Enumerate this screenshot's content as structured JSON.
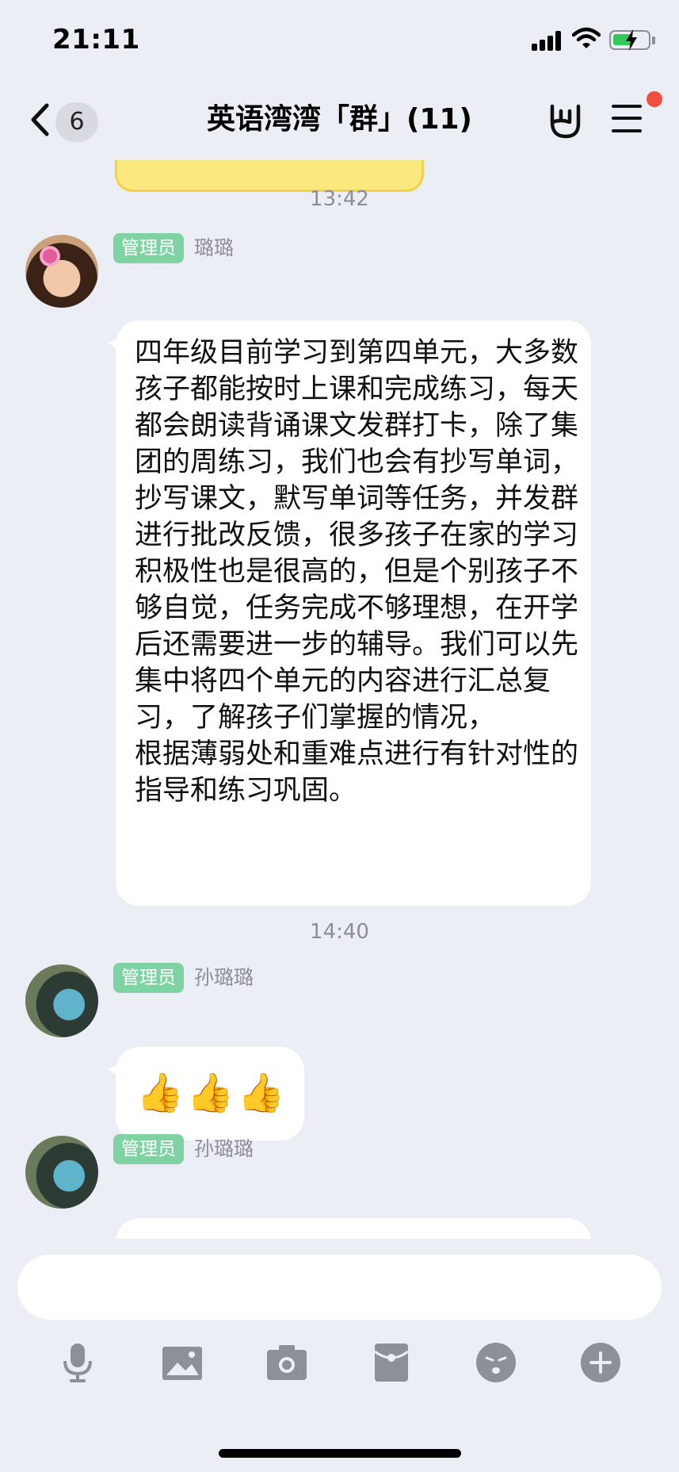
{
  "status_bar": {
    "time": "21:11"
  },
  "header": {
    "unread_count": "6",
    "title": "英语湾湾「群」(11)"
  },
  "messages": [
    {
      "time": "13:42",
      "role": "管理员",
      "sender": "璐璐",
      "text": "四年级目前学习到第四单元，大多数孩子都能按时上课和完成练习，每天都会朗读背诵课文发群打卡，除了集团的周练习，我们也会有抄写单词，抄写课文，默写单词等任务，并发群进行批改反馈，很多孩子在家的学习积极性也是很高的，但是个别孩子不够自觉，任务完成不够理想，在开学后还需要进一步的辅导。我们可以先集中将四个单元的内容进行汇总复习，了解孩子们掌握的情况，\n根据薄弱处和重难点进行有针对性的指导和练习巩固。"
    },
    {
      "time": "14:40",
      "role": "管理员",
      "sender": "孙璐璐",
      "text": "👍👍👍"
    },
    {
      "role": "管理员",
      "sender": "孙璐璐",
      "text": ""
    }
  ],
  "input": {
    "placeholder": ""
  },
  "toolbar": [
    "microphone-icon",
    "image-icon",
    "camera-icon",
    "red-packet-icon",
    "emoji-icon",
    "plus-icon"
  ],
  "colors": {
    "background": "#eceef5",
    "admin_badge": "#7fd3a3",
    "notification_dot": "#f04e3e",
    "bubble": "#ffffff"
  }
}
